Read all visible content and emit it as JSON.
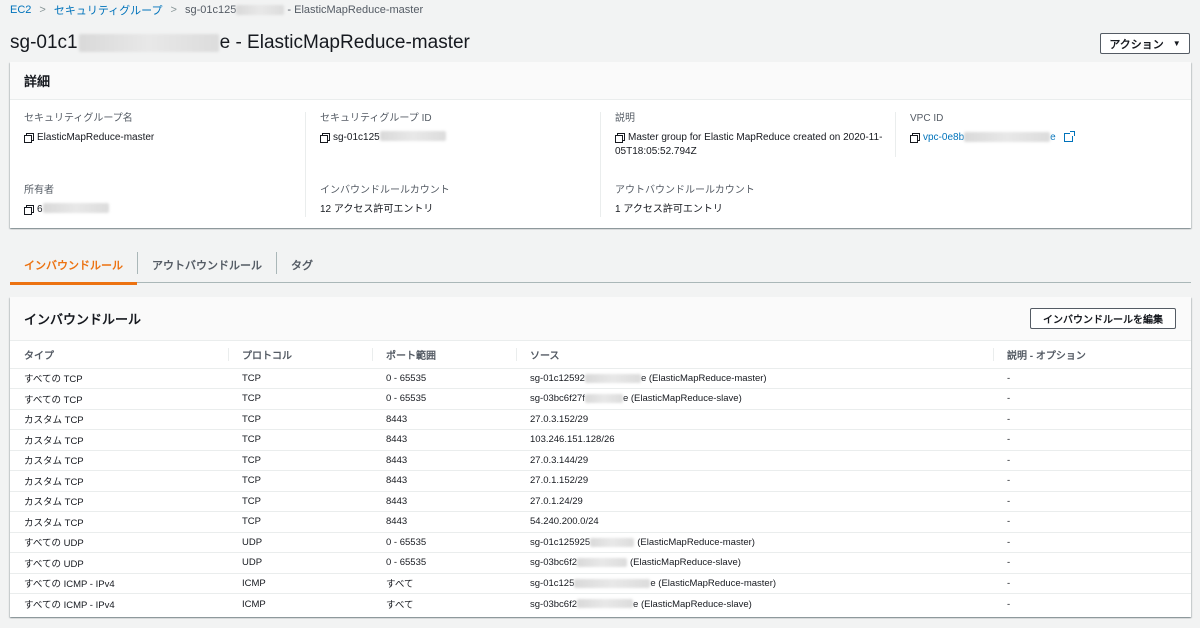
{
  "breadcrumb": {
    "items": [
      "EC2",
      "セキュリティグループ"
    ],
    "current_prefix": "sg-01c125",
    "current_suffix": "- ElasticMapReduce-master"
  },
  "page": {
    "title_prefix": "sg-01c1",
    "title_suffix": "e - ElasticMapReduce-master",
    "action_label": "アクション"
  },
  "details": {
    "header": "詳細",
    "sg_name_label": "セキュリティグループ名",
    "sg_name": "ElasticMapReduce-master",
    "sg_id_label": "セキュリティグループ ID",
    "sg_id_prefix": "sg-01c125",
    "desc_label": "説明",
    "desc_line1": "Master group for Elastic MapReduce created on 2020-11-",
    "desc_line2": "05T18:05:52.794Z",
    "vpc_label": "VPC ID",
    "vpc_prefix": "vpc-0e8b",
    "vpc_suffix": "e",
    "owner_label": "所有者",
    "owner_prefix": "6",
    "inbound_count_label": "インバウンドルールカウント",
    "inbound_count": "12 アクセス許可エントリ",
    "outbound_count_label": "アウトバウンドルールカウント",
    "outbound_count": "1 アクセス許可エントリ"
  },
  "tabs": [
    {
      "label": "インバウンドルール",
      "active": true
    },
    {
      "label": "アウトバウンドルール",
      "active": false
    },
    {
      "label": "タグ",
      "active": false
    }
  ],
  "rules": {
    "title": "インバウンドルール",
    "edit_label": "インバウンドルールを編集",
    "columns": [
      "タイプ",
      "プロトコル",
      "ポート範囲",
      "ソース",
      "説明 - オプション"
    ],
    "rows": [
      {
        "type": "すべての TCP",
        "protocol": "TCP",
        "port": "0 - 65535",
        "src_prefix": "sg-01c12592",
        "src_suffix": "e (ElasticMapReduce-master)",
        "desc": "-"
      },
      {
        "type": "すべての TCP",
        "protocol": "TCP",
        "port": "0 - 65535",
        "src_prefix": "sg-03bc6f27f",
        "src_suffix": "e (ElasticMapReduce-slave)",
        "desc": "-"
      },
      {
        "type": "カスタム TCP",
        "protocol": "TCP",
        "port": "8443",
        "src_prefix": "27.0.3.152/29",
        "src_suffix": "",
        "desc": "-"
      },
      {
        "type": "カスタム TCP",
        "protocol": "TCP",
        "port": "8443",
        "src_prefix": "103.246.151.128/26",
        "src_suffix": "",
        "desc": "-"
      },
      {
        "type": "カスタム TCP",
        "protocol": "TCP",
        "port": "8443",
        "src_prefix": "27.0.3.144/29",
        "src_suffix": "",
        "desc": "-"
      },
      {
        "type": "カスタム TCP",
        "protocol": "TCP",
        "port": "8443",
        "src_prefix": "27.0.1.152/29",
        "src_suffix": "",
        "desc": "-"
      },
      {
        "type": "カスタム TCP",
        "protocol": "TCP",
        "port": "8443",
        "src_prefix": "27.0.1.24/29",
        "src_suffix": "",
        "desc": "-"
      },
      {
        "type": "カスタム TCP",
        "protocol": "TCP",
        "port": "8443",
        "src_prefix": "54.240.200.0/24",
        "src_suffix": "",
        "desc": "-"
      },
      {
        "type": "すべての UDP",
        "protocol": "UDP",
        "port": "0 - 65535",
        "src_prefix": "sg-01c125925",
        "src_suffix": "(ElasticMapReduce-master)",
        "desc": "-"
      },
      {
        "type": "すべての UDP",
        "protocol": "UDP",
        "port": "0 - 65535",
        "src_prefix": "sg-03bc6f2",
        "src_suffix": "(ElasticMapReduce-slave)",
        "desc": "-"
      },
      {
        "type": "すべての ICMP - IPv4",
        "protocol": "ICMP",
        "port": "すべて",
        "src_prefix": "sg-01c125",
        "src_suffix": "e (ElasticMapReduce-master)",
        "desc": "-"
      },
      {
        "type": "すべての ICMP - IPv4",
        "protocol": "ICMP",
        "port": "すべて",
        "src_prefix": "sg-03bc6f2",
        "src_suffix": "e (ElasticMapReduce-slave)",
        "desc": "-"
      }
    ]
  }
}
